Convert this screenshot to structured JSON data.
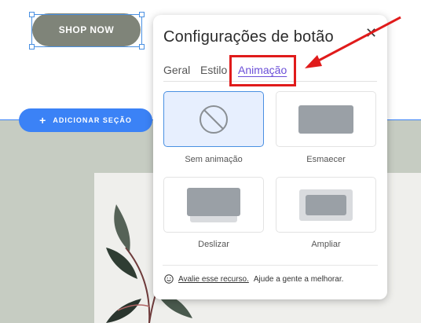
{
  "canvas": {
    "shop_button_label": "SHOP NOW",
    "add_section_label": "ADICIONAR SEÇÃO"
  },
  "panel": {
    "title": "Configurações de botão",
    "close_icon": "close-icon",
    "tabs": [
      {
        "label": "Geral"
      },
      {
        "label": "Estilo"
      },
      {
        "label": "Animação",
        "active": true
      }
    ],
    "options": [
      {
        "label": "Sem animação",
        "icon": "no-animation-icon",
        "selected": true
      },
      {
        "label": "Esmaecer",
        "icon": "fade-icon",
        "selected": false
      },
      {
        "label": "Deslizar",
        "icon": "slide-icon",
        "selected": false
      },
      {
        "label": "Ampliar",
        "icon": "zoom-icon",
        "selected": false
      }
    ],
    "footer": {
      "link": "Avalie esse recurso.",
      "text": "Ajude a gente a melhorar."
    }
  },
  "colors": {
    "accent_blue": "#3b82f6",
    "active_tab": "#6b4fd8",
    "annotation_red": "#e01b1b",
    "tile_selected_bg": "#e7effe",
    "shop_button_bg": "#7f8479"
  }
}
